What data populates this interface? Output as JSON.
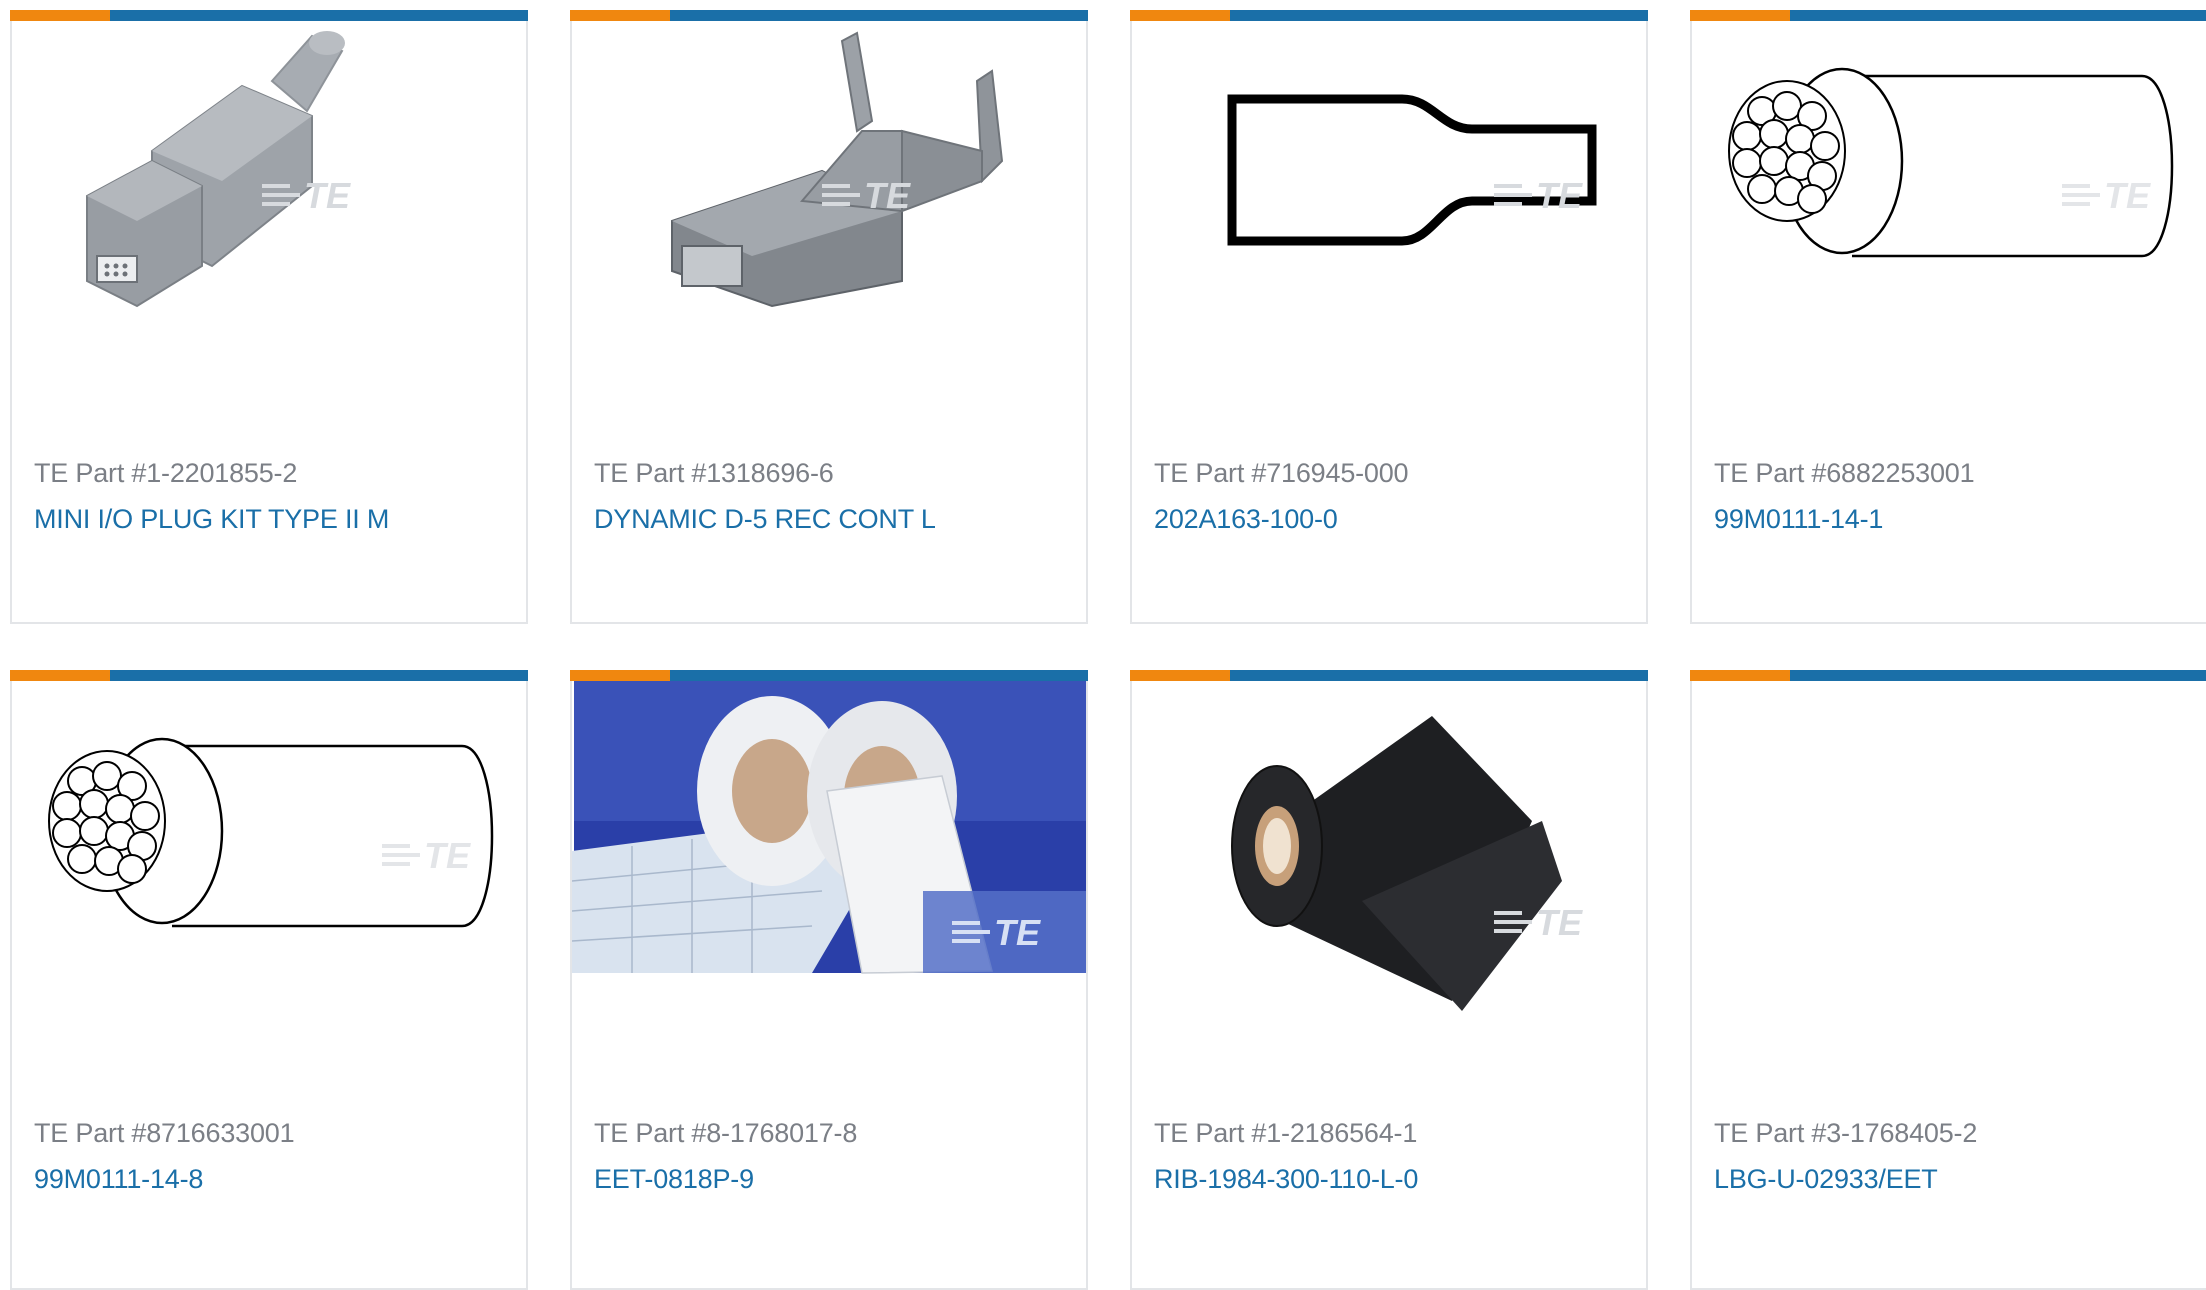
{
  "colors": {
    "accent_orange": "#f0870f",
    "accent_blue": "#1a6fa8",
    "part_label": "#7b7f86",
    "border": "#e3e5e8"
  },
  "watermark": "TE",
  "products": [
    {
      "part": "TE Part #1-2201855-2",
      "name": "MINI I/O PLUG KIT TYPE II M",
      "image": "connector-plug-image"
    },
    {
      "part": "TE Part #1318696-6",
      "name": "DYNAMIC D-5 REC CONT L",
      "image": "receptacle-contact-image"
    },
    {
      "part": "TE Part #716945-000",
      "name": "202A163-100-0",
      "image": "heat-shrink-boot-image"
    },
    {
      "part": "TE Part #6882253001",
      "name": "99M0111-14-1",
      "image": "stranded-wire-image"
    },
    {
      "part": "TE Part #8716633001",
      "name": "99M0111-14-8",
      "image": "stranded-wire-image"
    },
    {
      "part": "TE Part #8-1768017-8",
      "name": "EET-0818P-9",
      "image": "label-rolls-image"
    },
    {
      "part": "TE Part #1-2186564-1",
      "name": "RIB-1984-300-110-L-0",
      "image": "ribbon-roll-image"
    },
    {
      "part": "TE Part #3-1768405-2",
      "name": "LBG-U-02933/EET",
      "image": "no-image"
    }
  ]
}
